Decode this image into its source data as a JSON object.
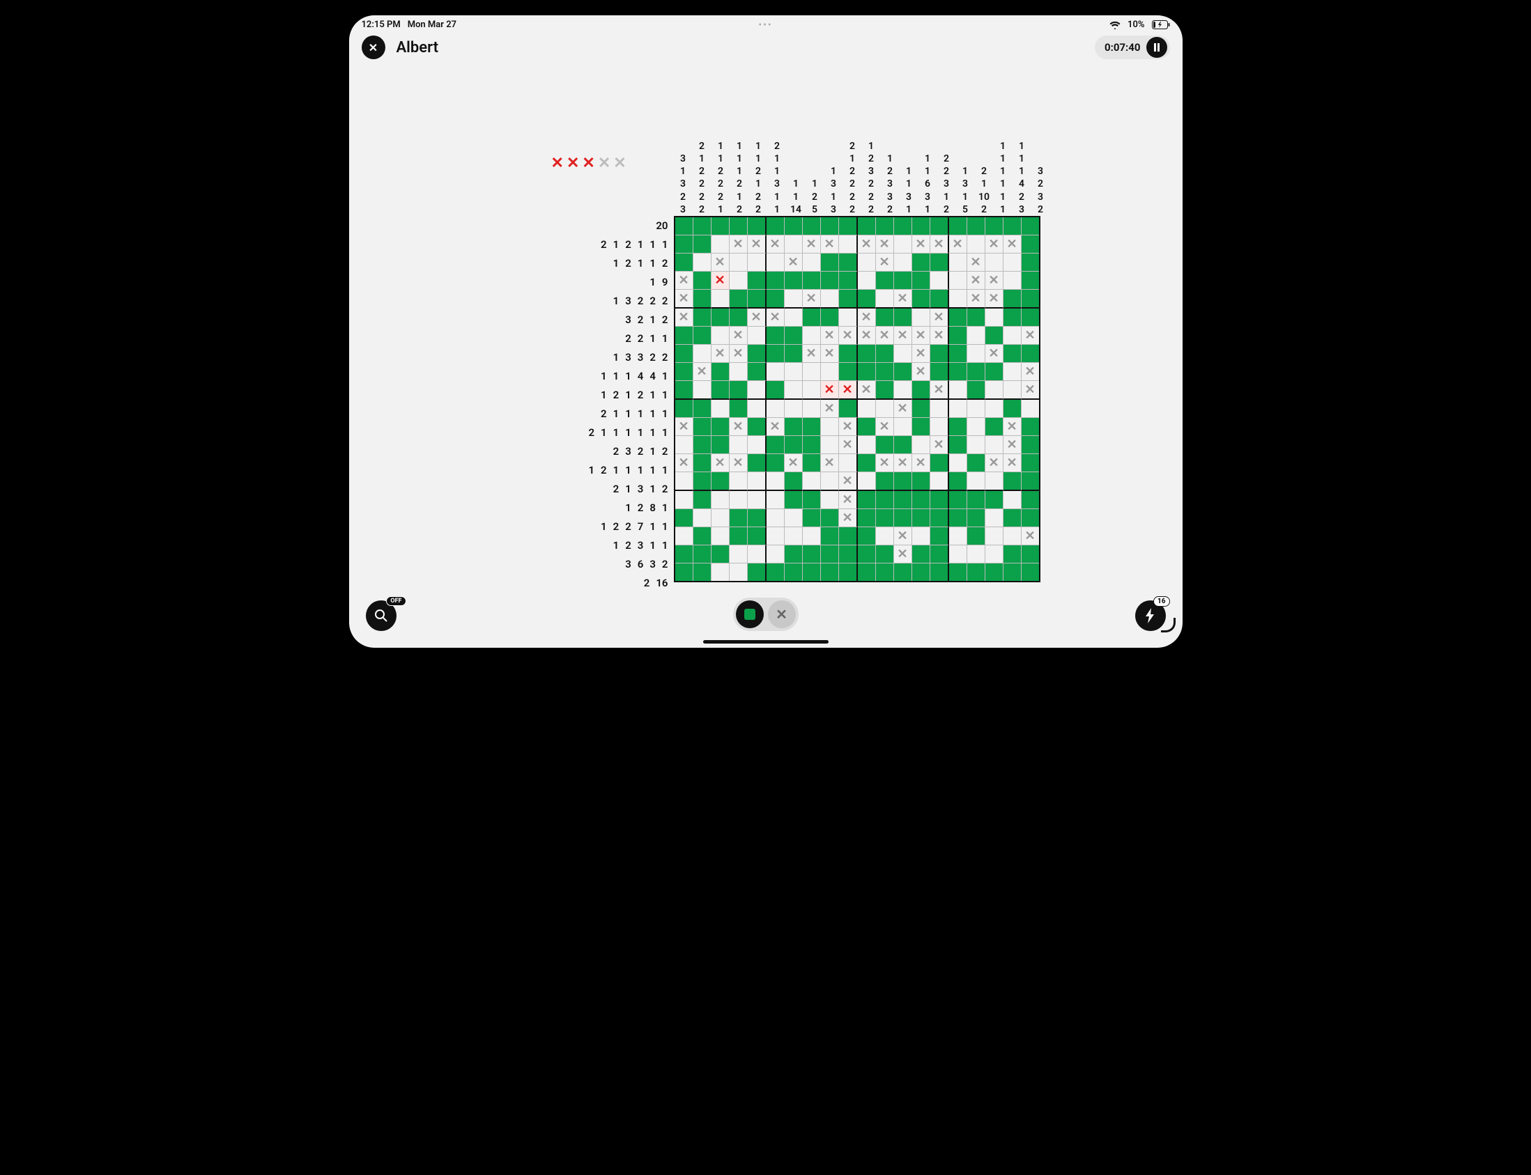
{
  "status": {
    "time": "12:15 PM",
    "date": "Mon Mar 27",
    "battery_pct": "10%"
  },
  "header": {
    "title": "Albert",
    "timer": "0:07:40"
  },
  "lives": {
    "lost": 3,
    "remaining": 2
  },
  "zoom": {
    "badge": "OFF"
  },
  "hints": {
    "count": "16"
  },
  "col_clues": [
    {
      "nums": [
        "3",
        "1",
        "3",
        "2",
        "3"
      ],
      "completed": false
    },
    {
      "nums": [
        "2",
        "1",
        "2",
        "2",
        "2",
        "2"
      ],
      "completed": false
    },
    {
      "nums": [
        "1",
        "1",
        "2",
        "2",
        "2",
        "1"
      ],
      "completed": false
    },
    {
      "nums": [
        "1",
        "1",
        "1",
        "2",
        "1",
        "2"
      ],
      "completed": false
    },
    {
      "nums": [
        "1",
        "1",
        "2",
        "1",
        "2",
        "2"
      ],
      "completed": false
    },
    {
      "nums": [
        "2",
        "1",
        "1",
        "3",
        "1",
        "1"
      ],
      "completed": false
    },
    {
      "nums": [
        "1",
        "1",
        "14"
      ],
      "completed": false
    },
    {
      "nums": [
        "1",
        "2",
        "5"
      ],
      "completed": false
    },
    {
      "nums": [
        "1",
        "3",
        "1",
        "3"
      ],
      "completed": true
    },
    {
      "nums": [
        "2",
        "1",
        "2",
        "2",
        "2",
        "2"
      ],
      "completed": false
    },
    {
      "nums": [
        "1",
        "2",
        "3",
        "2",
        "2",
        "2"
      ],
      "completed": false
    },
    {
      "nums": [
        "1",
        "2",
        "3",
        "3",
        "2"
      ],
      "completed": false
    },
    {
      "nums": [
        "1",
        "1",
        "3",
        "1"
      ],
      "completed": true
    },
    {
      "nums": [
        "1",
        "1",
        "6",
        "3",
        "1"
      ],
      "completed": false
    },
    {
      "nums": [
        "2",
        "2",
        "3",
        "1",
        "2"
      ],
      "completed": false
    },
    {
      "nums": [
        "1",
        "3",
        "1",
        "5"
      ],
      "completed": false
    },
    {
      "nums": [
        "2",
        "1",
        "10",
        "2"
      ],
      "completed": false
    },
    {
      "nums": [
        "1",
        "1",
        "1",
        "1",
        "1",
        "1"
      ],
      "completed": false
    },
    {
      "nums": [
        "1",
        "1",
        "1",
        "4",
        "2",
        "3"
      ],
      "completed": false
    },
    {
      "nums": [
        "3",
        "2",
        "3",
        "2"
      ],
      "completed": true
    }
  ],
  "row_clues": [
    {
      "nums": [
        "20"
      ],
      "completed": true
    },
    {
      "nums": [
        "2",
        "1",
        "2",
        "1",
        "1",
        "1"
      ],
      "completed": false
    },
    {
      "nums": [
        "1",
        "2",
        "1",
        "1",
        "2"
      ],
      "completed": false
    },
    {
      "nums": [
        "1",
        "9"
      ],
      "completed": true
    },
    {
      "nums": [
        "1",
        "3",
        "2",
        "2",
        "2"
      ],
      "completed": false
    },
    {
      "nums": [
        "3",
        "2",
        "1",
        "2"
      ],
      "completed": false
    },
    {
      "nums": [
        "2",
        "2",
        "1",
        "1"
      ],
      "completed": false
    },
    {
      "nums": [
        "1",
        "3",
        "3",
        "2",
        "2"
      ],
      "completed": false
    },
    {
      "nums": [
        "1",
        "1",
        "1",
        "4",
        "4",
        "1"
      ],
      "completed": false
    },
    {
      "nums": [
        "1",
        "2",
        "1",
        "2",
        "1",
        "1"
      ],
      "completed": false
    },
    {
      "nums": [
        "2",
        "1",
        "1",
        "1",
        "1",
        "1"
      ],
      "completed": false
    },
    {
      "nums": [
        "2",
        "1",
        "1",
        "1",
        "1",
        "1",
        "1"
      ],
      "completed": true
    },
    {
      "nums": [
        "2",
        "3",
        "2",
        "1",
        "2"
      ],
      "completed": false
    },
    {
      "nums": [
        "1",
        "2",
        "1",
        "1",
        "1",
        "1",
        "1"
      ],
      "completed": true
    },
    {
      "nums": [
        "2",
        "1",
        "3",
        "1",
        "2"
      ],
      "completed": false
    },
    {
      "nums": [
        "1",
        "2",
        "8",
        "1"
      ],
      "completed": false
    },
    {
      "nums": [
        "1",
        "2",
        "2",
        "7",
        "1",
        "1"
      ],
      "completed": false
    },
    {
      "nums": [
        "1",
        "2",
        "3",
        "1",
        "1"
      ],
      "completed": false
    },
    {
      "nums": [
        "3",
        "6",
        "3",
        "2"
      ],
      "completed": false
    },
    {
      "nums": [
        "2",
        "16"
      ],
      "completed": false
    }
  ],
  "grid": [
    "ffffffffffffffffffff",
    "ff.xxx.xx.xx.xxx.xxf",
    "f.x...x.ff.x.ff.x..f",
    "xfe.ffffff.fff..xx.f",
    "xf.fff.x.ff.xff.xxff",
    "xfffxx.ff.xff.xff.ff",
    "ff.x.ff.xxxxxxxf.f.x",
    "f.xxfffxxfff.xff.xff",
    "fxf.f....ffffxffff.x",
    "f.ff.f..eexf.fx.f..x",
    "ff.f....xf..xf....f.",
    "xffxfxff.xfx.f.f.fxf",
    ".ff..fff.x.ff.xf..xf",
    "xfxxffxfx.fxxxf.fxxf",
    ".ff...f..x.fff.f..ff",
    ".f....ff.xffffffff.f",
    "f..ff..ffxfffffff.ff",
    ".f.ff...fff.x.f.f..x",
    "fff...ffffffxff...ff",
    "ff..ffffffffffffffff"
  ]
}
